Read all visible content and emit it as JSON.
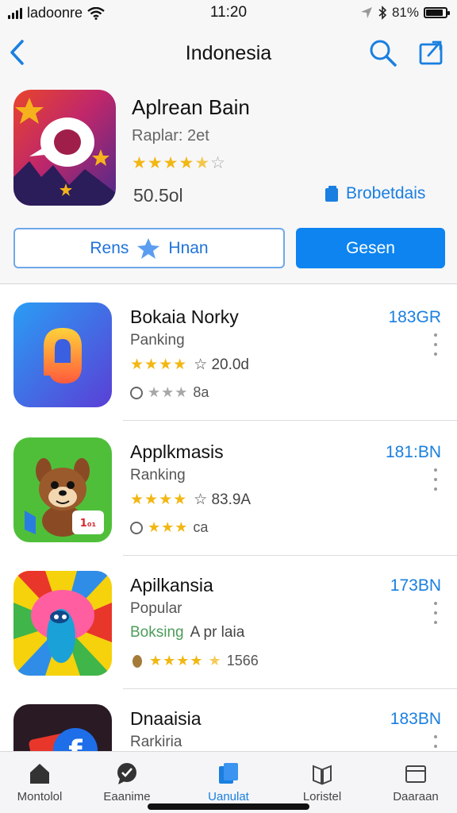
{
  "status_bar": {
    "carrier": "ladoonre",
    "time": "11:20",
    "battery": "81%",
    "battery_level": 0.81
  },
  "nav": {
    "title": "Indonesia",
    "back_icon": "chevron-left-icon",
    "search_icon": "search-icon",
    "share_icon": "share-icon"
  },
  "featured": {
    "name": "Aplrean Bain",
    "subtitle": "Raplar: 2et",
    "rating": 4.5,
    "count": "50.5ol",
    "link_label": "Brobetdais",
    "outline_button_left": "Rens",
    "outline_button_right": "Hnan",
    "solid_button": "Gesen"
  },
  "apps": [
    {
      "name": "Bokaia Norky",
      "category": "Panking",
      "stars": "★★★★",
      "rating_text": "☆ 20.0d",
      "minor_stars": "★★★",
      "minor_text": "8a",
      "size": "183GR"
    },
    {
      "name": "Applkmasis",
      "category": "Ranking",
      "stars": "★★★★",
      "rating_text": "☆ 83.9A",
      "minor_stars": "★★★",
      "minor_text": "ca",
      "size": "181:BN"
    },
    {
      "name": "Apilkansia",
      "category": "Popular",
      "extra_green": "Boksing",
      "extra_grey": "A pr laia",
      "stars": "★★★★",
      "rating_text": "1566",
      "size": "173BN"
    },
    {
      "name": "Dnaaisia",
      "category": "Rarkiria",
      "size": "183BN"
    }
  ],
  "tabbar": {
    "items": [
      {
        "label": "Montolol",
        "icon": "home-icon"
      },
      {
        "label": "Eaanime",
        "icon": "chat-icon"
      },
      {
        "label": "Uanulat",
        "icon": "apps-icon"
      },
      {
        "label": "Loristel",
        "icon": "books-icon"
      },
      {
        "label": "Daaraan",
        "icon": "folder-icon"
      }
    ],
    "active_index": 2
  },
  "colors": {
    "accent": "#0d84f0",
    "star": "#f2b713"
  }
}
